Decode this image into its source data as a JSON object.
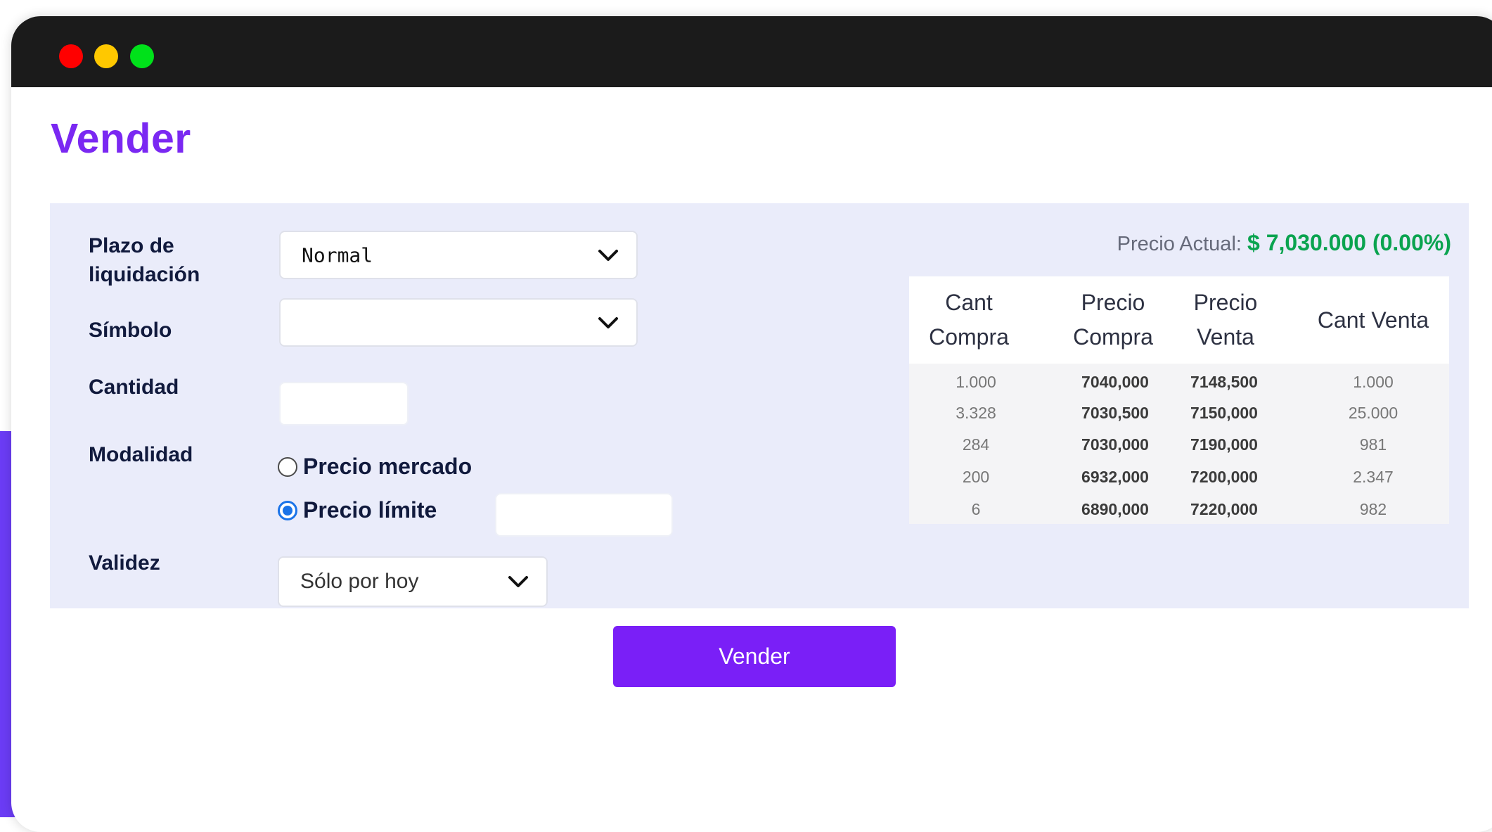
{
  "window": {
    "controls": [
      "close",
      "minimize",
      "maximize"
    ]
  },
  "page": {
    "title": "Vender"
  },
  "form": {
    "plazo": {
      "label": "Plazo de liquidación",
      "value": "Normal"
    },
    "simbolo": {
      "label": "Símbolo",
      "value": ""
    },
    "cantidad": {
      "label": "Cantidad",
      "value": ""
    },
    "modalidad": {
      "label": "Modalidad",
      "options": [
        {
          "label": "Precio mercado",
          "checked": false
        },
        {
          "label": "Precio límite",
          "checked": true
        }
      ],
      "limit_price": ""
    },
    "validez": {
      "label": "Validez",
      "value": "Sólo por hoy"
    },
    "submit_label": "Vender"
  },
  "market": {
    "price_label": "Precio Actual:",
    "price_value": "$ 7,030.000 (0.00%)",
    "columns": [
      "Cant Compra",
      "Precio Compra",
      "Precio Venta",
      "Cant Venta"
    ],
    "rows": [
      [
        "1.000",
        "7040,000",
        "7148,500",
        "1.000"
      ],
      [
        "3.328",
        "7030,500",
        "7150,000",
        "25.000"
      ],
      [
        "284",
        "7030,000",
        "7190,000",
        "981"
      ],
      [
        "200",
        "6932,000",
        "7200,000",
        "2.347"
      ],
      [
        "6",
        "6890,000",
        "7220,000",
        "982"
      ]
    ]
  },
  "colors": {
    "accent": "#7a28f2",
    "panel": "#eaecfa",
    "price_green": "#0aa34f"
  },
  "icons": [
    "chevron-down-icon",
    "radio-icon"
  ]
}
